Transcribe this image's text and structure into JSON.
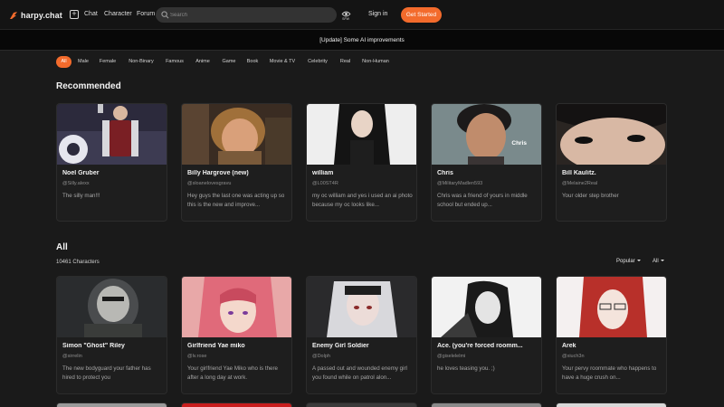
{
  "brand": {
    "name": "harpy.chat",
    "accent": "#f36b2c"
  },
  "nav": {
    "links": [
      "Chat",
      "Character",
      "Forum"
    ],
    "search_placeholder": "Search",
    "nsfw_label": "SFW",
    "signin": "Sign in",
    "get_started": "Get Started"
  },
  "banner": "[Update] Some AI improvements",
  "filters": [
    "All",
    "Male",
    "Female",
    "Non-Binary",
    "Famous",
    "Anime",
    "Game",
    "Book",
    "Movie & TV",
    "Celebrity",
    "Real",
    "Non-Human"
  ],
  "active_filter": "All",
  "recommended": {
    "title": "Recommended",
    "cards": [
      {
        "name": "Noel Gruber",
        "handle": "@Silly.alexx",
        "desc": "The silly man!!!",
        "overlay": ""
      },
      {
        "name": "Billy Hargrove (new)",
        "handle": "@sloanelovesgravu",
        "desc": "Hey guys the last one was acting up so this is the new and improve...",
        "overlay": ""
      },
      {
        "name": "william",
        "handle": "@L00ST4R",
        "desc": "my oc william and yes i used an ai photo because my oc looks like...",
        "overlay": ""
      },
      {
        "name": "Chris",
        "handle": "@MilitaryMadlen593",
        "desc": "Chris was a friend of yours in middle school but ended up...",
        "overlay": "Chris"
      },
      {
        "name": "Bill Kaulitz.",
        "handle": "@Melaine2Real",
        "desc": "Your older step brother",
        "overlay": ""
      }
    ]
  },
  "all": {
    "title": "All",
    "count": "10461 Characters",
    "sort": "Popular",
    "filter": "All",
    "cards": [
      {
        "name": "Simon \"Ghost\" Riley",
        "handle": "@sirrelin",
        "desc": "The new bodyguard your father has hired to protect you"
      },
      {
        "name": "Girlfriend Yae miko",
        "handle": "@lv.rose",
        "desc": "Your girlfriend Yae Miko who is there after a long day at work."
      },
      {
        "name": "Enemy Girl Soldier",
        "handle": "@Dolph",
        "desc": "A passed out and wounded enemy girl you found while on patrol alon..."
      },
      {
        "name": "Ace. (you're forced roomm...",
        "handle": "@giselelelmi",
        "desc": "he loves teasing you. ;)"
      },
      {
        "name": "Arek",
        "handle": "@xiuch3n",
        "desc": "Your pervy roommate who happens to have a huge crush on..."
      }
    ]
  },
  "icons": {
    "logo": "harpy-logo-icon",
    "create": "plus-square-icon",
    "search": "search-icon",
    "nsfw": "eye-icon",
    "sort": "chevron-down-icon"
  }
}
